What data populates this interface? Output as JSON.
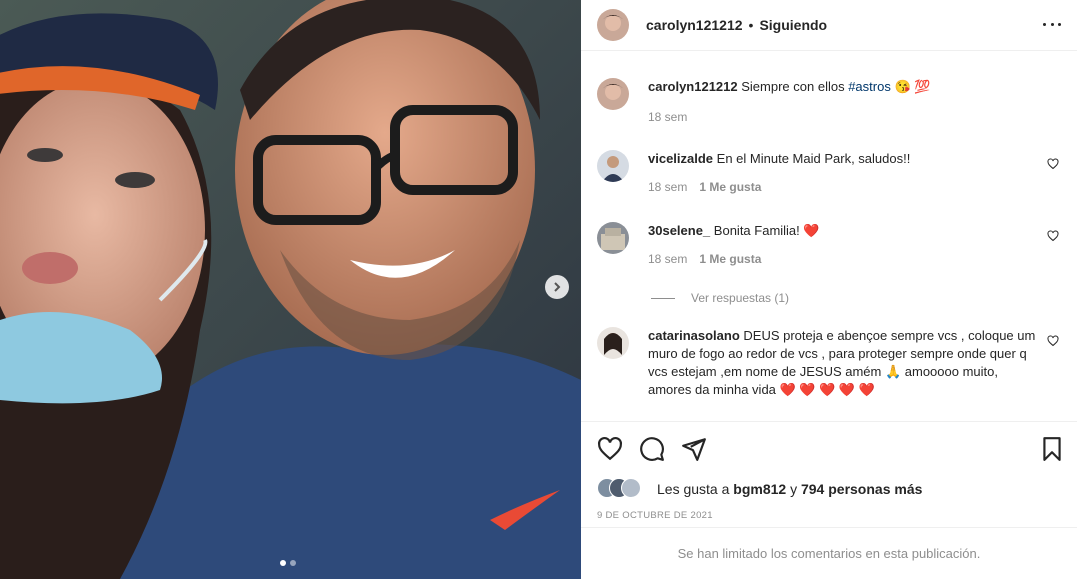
{
  "post": {
    "username": "carolyn121212",
    "separator": "•",
    "follow_status": "Siguiendo",
    "colors": {
      "link": "#00376b",
      "muted": "#8e8e8e",
      "heart": "#ed4956",
      "text": "#262626"
    }
  },
  "caption": {
    "username": "carolyn121212",
    "text": "Siempre con ellos ",
    "hashtag": "#astros",
    "emoji": "😘 💯",
    "time": "18 sem"
  },
  "comments": [
    {
      "username": "vicelizalde",
      "text": "En el Minute Maid Park, saludos!!",
      "time": "18 sem",
      "likes": "1 Me gusta"
    },
    {
      "username": "30selene_",
      "text": "Bonita Familia!",
      "emoji": "❤️",
      "time": "18 sem",
      "likes": "1 Me gusta"
    },
    {
      "username": "catarinasolano",
      "text": "DEUS proteja e abençoe sempre vcs , coloque um muro de fogo ao redor de vcs , para proteger sempre onde quer q vcs estejam ,em nome de JESUS amém 🙏 amooooo muito, amores da minha vida",
      "hearts": "❤️ ❤️ ❤️ ❤️ ❤️"
    }
  ],
  "replies_label": "Ver respuestas (1)",
  "likes": {
    "prefix": "Les gusta a ",
    "user": "bgm812",
    "middle": " y ",
    "count": "794 personas más"
  },
  "date": "9 DE OCTUBRE DE 2021",
  "footer": "Se han limitado los comentarios en esta publicación.",
  "icons": [
    "like-icon",
    "comment-icon",
    "share-icon",
    "bookmark-icon",
    "more-icon",
    "next-arrow-icon"
  ]
}
